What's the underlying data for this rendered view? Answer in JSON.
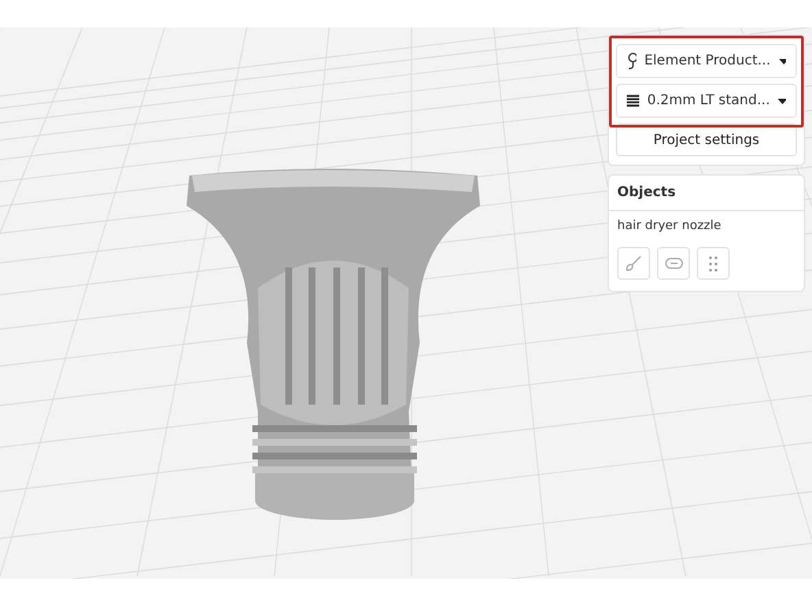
{
  "printer_select": {
    "label": "Element Product..."
  },
  "profile_select": {
    "label": "0.2mm LT stand..."
  },
  "project_settings_button": {
    "label": "Project settings"
  },
  "objects_panel": {
    "title": "Objects",
    "items": [
      {
        "name": "hair dryer nozzle"
      }
    ]
  }
}
